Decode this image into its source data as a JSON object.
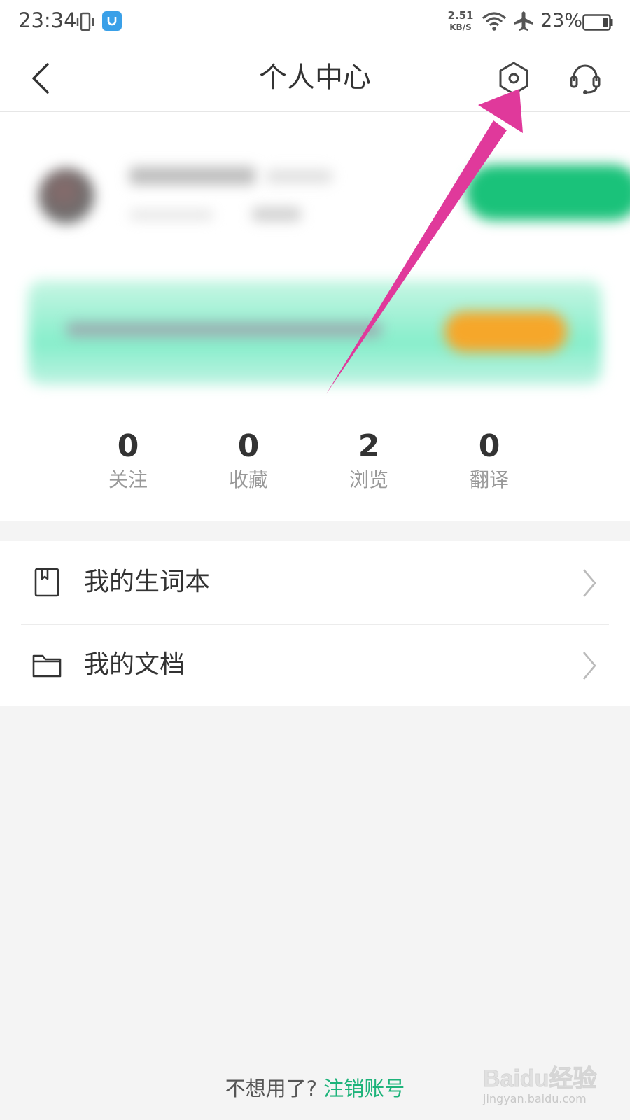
{
  "status_bar": {
    "time": "23:34",
    "net_speed_value": "2.51",
    "net_speed_unit": "KB/S",
    "battery_percent": "23%"
  },
  "header": {
    "title": "个人中心"
  },
  "stats": [
    {
      "value": "0",
      "label": "关注"
    },
    {
      "value": "0",
      "label": "收藏"
    },
    {
      "value": "2",
      "label": "浏览"
    },
    {
      "value": "0",
      "label": "翻译"
    }
  ],
  "menu": [
    {
      "label": "我的生词本",
      "icon": "bookmark-book-icon"
    },
    {
      "label": "我的文档",
      "icon": "folder-icon"
    }
  ],
  "footer": {
    "prompt": "不想用了?",
    "link": "注销账号"
  },
  "watermark": {
    "brand": "Baidu经验",
    "url": "jingyan.baidu.com"
  },
  "colors": {
    "accent_green": "#1db37a",
    "vip_green": "#1ac27a",
    "banner_orange": "#f6a72a",
    "arrow_pink": "#e0399b"
  }
}
